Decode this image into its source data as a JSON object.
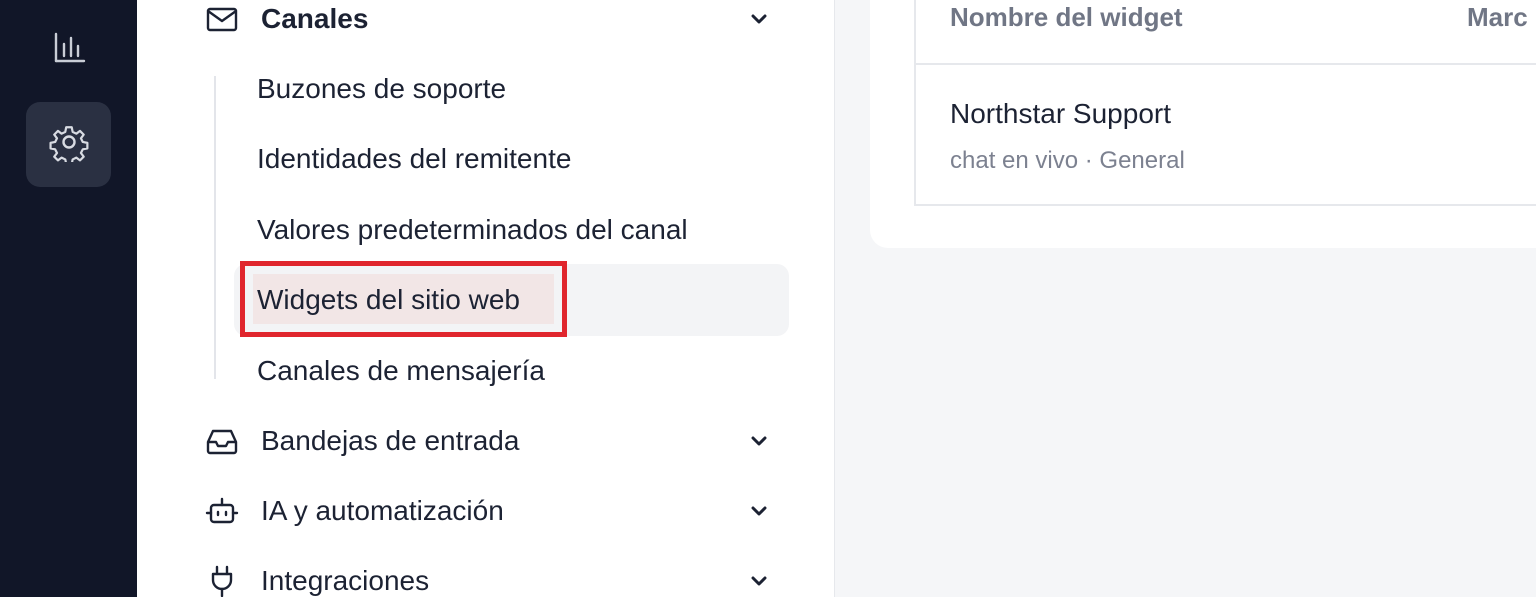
{
  "rail": {
    "items": [
      {
        "icon": "bar-chart-icon",
        "active": false
      },
      {
        "icon": "gear-icon",
        "active": true
      }
    ]
  },
  "nav": {
    "groups": [
      {
        "icon": "mail-icon",
        "label": "Canales",
        "expanded": true,
        "children": [
          {
            "label": "Buzones de soporte"
          },
          {
            "label": "Identidades del remitente"
          },
          {
            "label": "Valores predeterminados del canal"
          },
          {
            "label": "Widgets del sitio web",
            "active": true
          },
          {
            "label": "Canales de mensajería"
          }
        ]
      },
      {
        "icon": "inbox-icon",
        "label": "Bandejas de entrada",
        "expanded": false
      },
      {
        "icon": "robot-icon",
        "label": "IA y automatización",
        "expanded": false
      },
      {
        "icon": "plug-icon",
        "label": "Integraciones",
        "expanded": false
      }
    ]
  },
  "main": {
    "table": {
      "columns": [
        "Nombre del widget",
        "Marc"
      ],
      "rows": [
        {
          "name": "Northstar Support",
          "meta": "chat en vivo · General"
        }
      ]
    }
  },
  "colors": {
    "rail_bg": "#111628",
    "highlight": "#e0262d",
    "text": "#1c2233",
    "muted": "#7c8190"
  }
}
